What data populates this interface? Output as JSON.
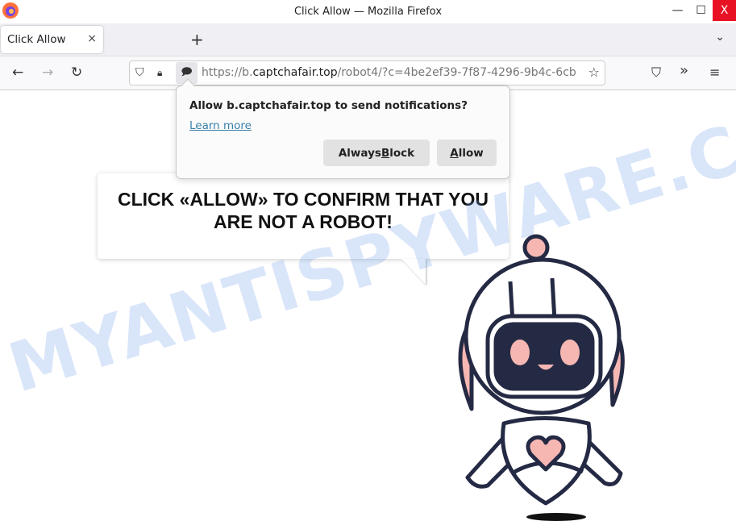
{
  "window": {
    "title": "Click Allow — Mozilla Firefox",
    "controls": {
      "minimize": "—",
      "maximize": "☐",
      "close": "X"
    }
  },
  "tabs": [
    {
      "label": "Click Allow",
      "close": "×"
    }
  ],
  "tabbar": {
    "new_tab": "+",
    "list_all": "⌄"
  },
  "nav": {
    "back": "←",
    "forward": "→",
    "reload": "↻"
  },
  "urlbar": {
    "prefix": "https://b.",
    "domain": "captchafair.top",
    "path": "/robot4/?c=4be2ef39-7f87-4296-9b4c-6cb",
    "icons": {
      "shield": "⛉",
      "lock": "🔒︎",
      "notification": "🗩",
      "star": "☆"
    }
  },
  "toolbar_right": {
    "pocket": "⛉",
    "overflow": "»",
    "menu": "≡"
  },
  "notification_popup": {
    "message": "Allow b.captchafair.top to send notifications?",
    "learn_more": "Learn more",
    "block_label_pre": "Always ",
    "block_label_key": "B",
    "block_label_post": "lock",
    "allow_label_key": "A",
    "allow_label_post": "llow"
  },
  "page": {
    "headline": "CLICK «ALLOW» TO CONFIRM THAT YOU ARE NOT A ROBOT!",
    "watermark": "MYANTISPYWARE.COM",
    "colors": {
      "robot_outline": "#252a44",
      "robot_pink": "#f6b7b3",
      "url_domain": "#222222",
      "learn_more": "#3a7fa8"
    }
  }
}
